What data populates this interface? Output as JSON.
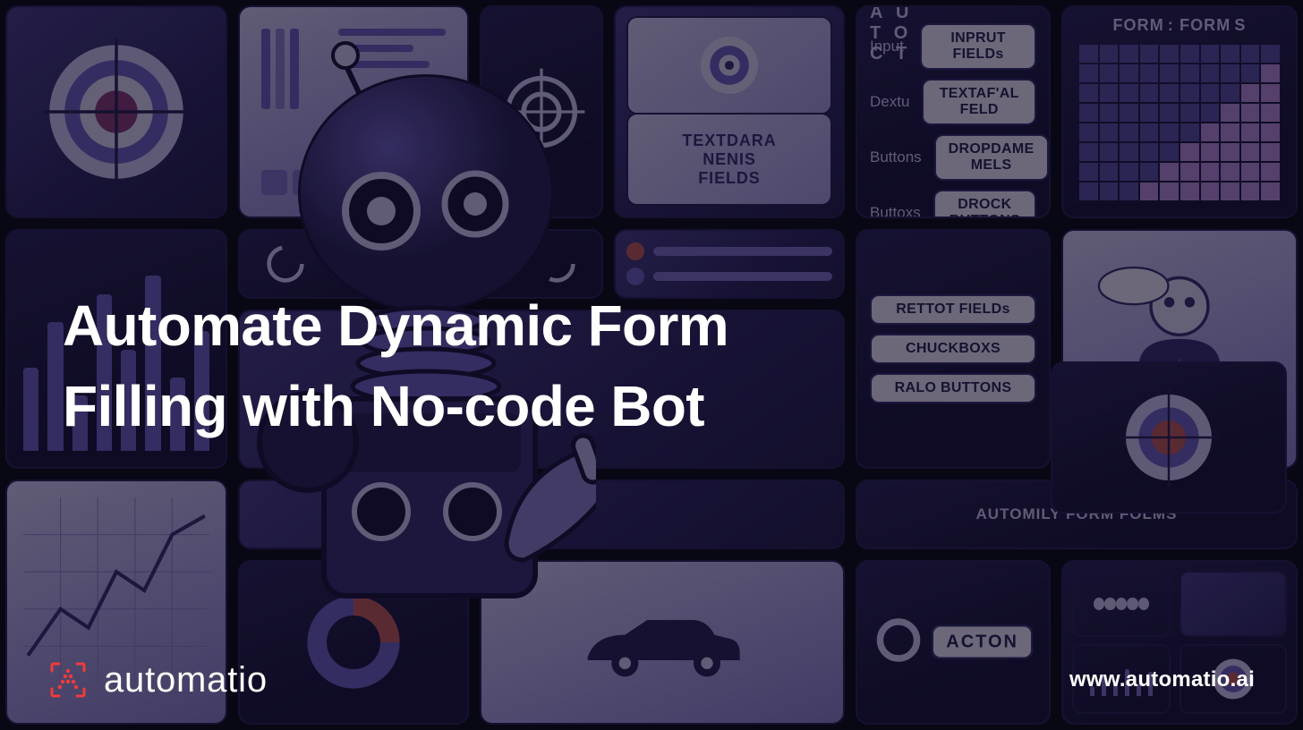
{
  "headline": "Automate Dynamic Form Filling with No-code Bot",
  "brand": {
    "name": "automatio",
    "url": "www.automatio.ai"
  },
  "bg": {
    "header_strip": "A U T O C T",
    "forms_header": "FORM : FORM S",
    "textdara": "TEXTDARA\nNENIS\nFIELDS",
    "middle_strip": "AUTOMILY FORM FOLMS",
    "acton_label": "ACTON",
    "form_rows_top": [
      {
        "label": "Input",
        "pill": "INPRUT FIELDs"
      },
      {
        "label": "Dextu",
        "pill": "TEXTAF'AL FELD"
      },
      {
        "label": "Buttons",
        "pill": "DROPDAME MELS"
      },
      {
        "label": "Buttoxs",
        "pill": "DROCK BUTTONS"
      }
    ],
    "form_rows_mid": [
      {
        "pill": "RETTOT FIELDs"
      },
      {
        "pill": "CHUCKBOXS"
      },
      {
        "pill": "RALO BUTTONS"
      }
    ]
  },
  "colors": {
    "bg": "#0d0c18",
    "tile_purple": "#4a3f8a",
    "tile_light": "#cfc6ef",
    "accent_red": "#ef3b3b"
  }
}
